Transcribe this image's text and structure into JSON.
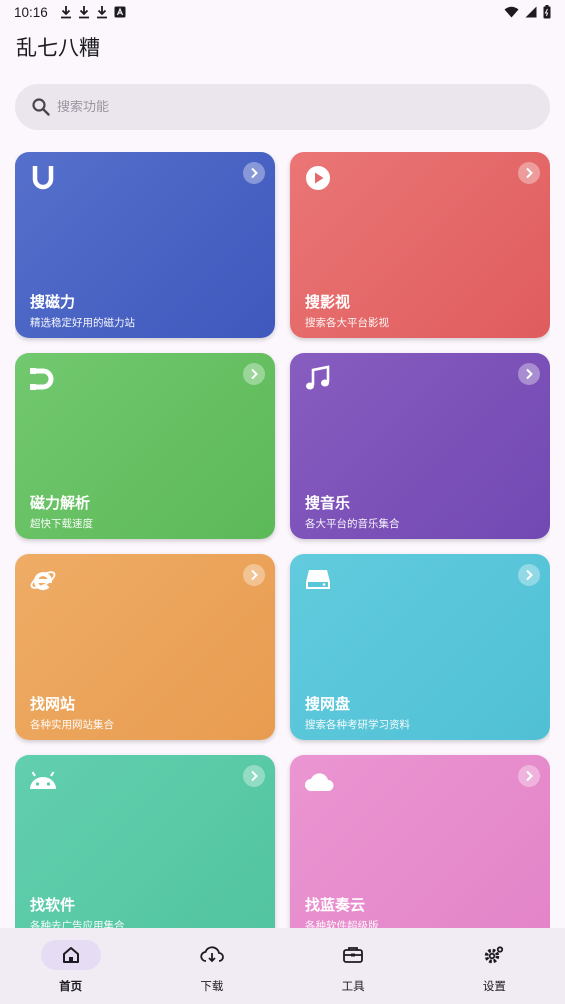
{
  "status_bar": {
    "time": "10:16",
    "left_icons": [
      "download-icon",
      "download-icon",
      "download-icon",
      "accessibility-icon"
    ],
    "right_icons": [
      "wifi-icon",
      "signal-icon",
      "battery-icon"
    ]
  },
  "app": {
    "title": "乱七八糟"
  },
  "search": {
    "placeholder": "搜索功能",
    "icon": "search-icon"
  },
  "cards": [
    {
      "title": "搜磁力",
      "subtitle": "精选稳定好用的磁力站",
      "icon": "magnet-u-icon",
      "color": "#4a64c4"
    },
    {
      "title": "搜影视",
      "subtitle": "搜索各大平台影视",
      "icon": "play-circle-icon",
      "color": "#e36a6a"
    },
    {
      "title": "磁力解析",
      "subtitle": "超快下载速度",
      "icon": "magnet-icon",
      "color": "#66c163"
    },
    {
      "title": "搜音乐",
      "subtitle": "各大平台的音乐集合",
      "icon": "music-note-icon",
      "color": "#7d52b8"
    },
    {
      "title": "找网站",
      "subtitle": "各种实用网站集合",
      "icon": "browser-e-icon",
      "color": "#eba45a"
    },
    {
      "title": "搜网盘",
      "subtitle": "搜索各种考研学习资料",
      "icon": "hard-drive-icon",
      "color": "#59c6da"
    },
    {
      "title": "找软件",
      "subtitle": "各种去广告应用集合",
      "icon": "android-icon",
      "color": "#5ccba7"
    },
    {
      "title": "找蓝奏云",
      "subtitle": "各种软件超级版",
      "icon": "cloud-icon",
      "color": "#e88ccd"
    }
  ],
  "nav": {
    "items": [
      {
        "label": "首页",
        "icon": "home-icon",
        "active": true
      },
      {
        "label": "下载",
        "icon": "cloud-download-icon",
        "active": false
      },
      {
        "label": "工具",
        "icon": "toolbox-icon",
        "active": false
      },
      {
        "label": "设置",
        "icon": "settings-icon",
        "active": false
      }
    ]
  }
}
